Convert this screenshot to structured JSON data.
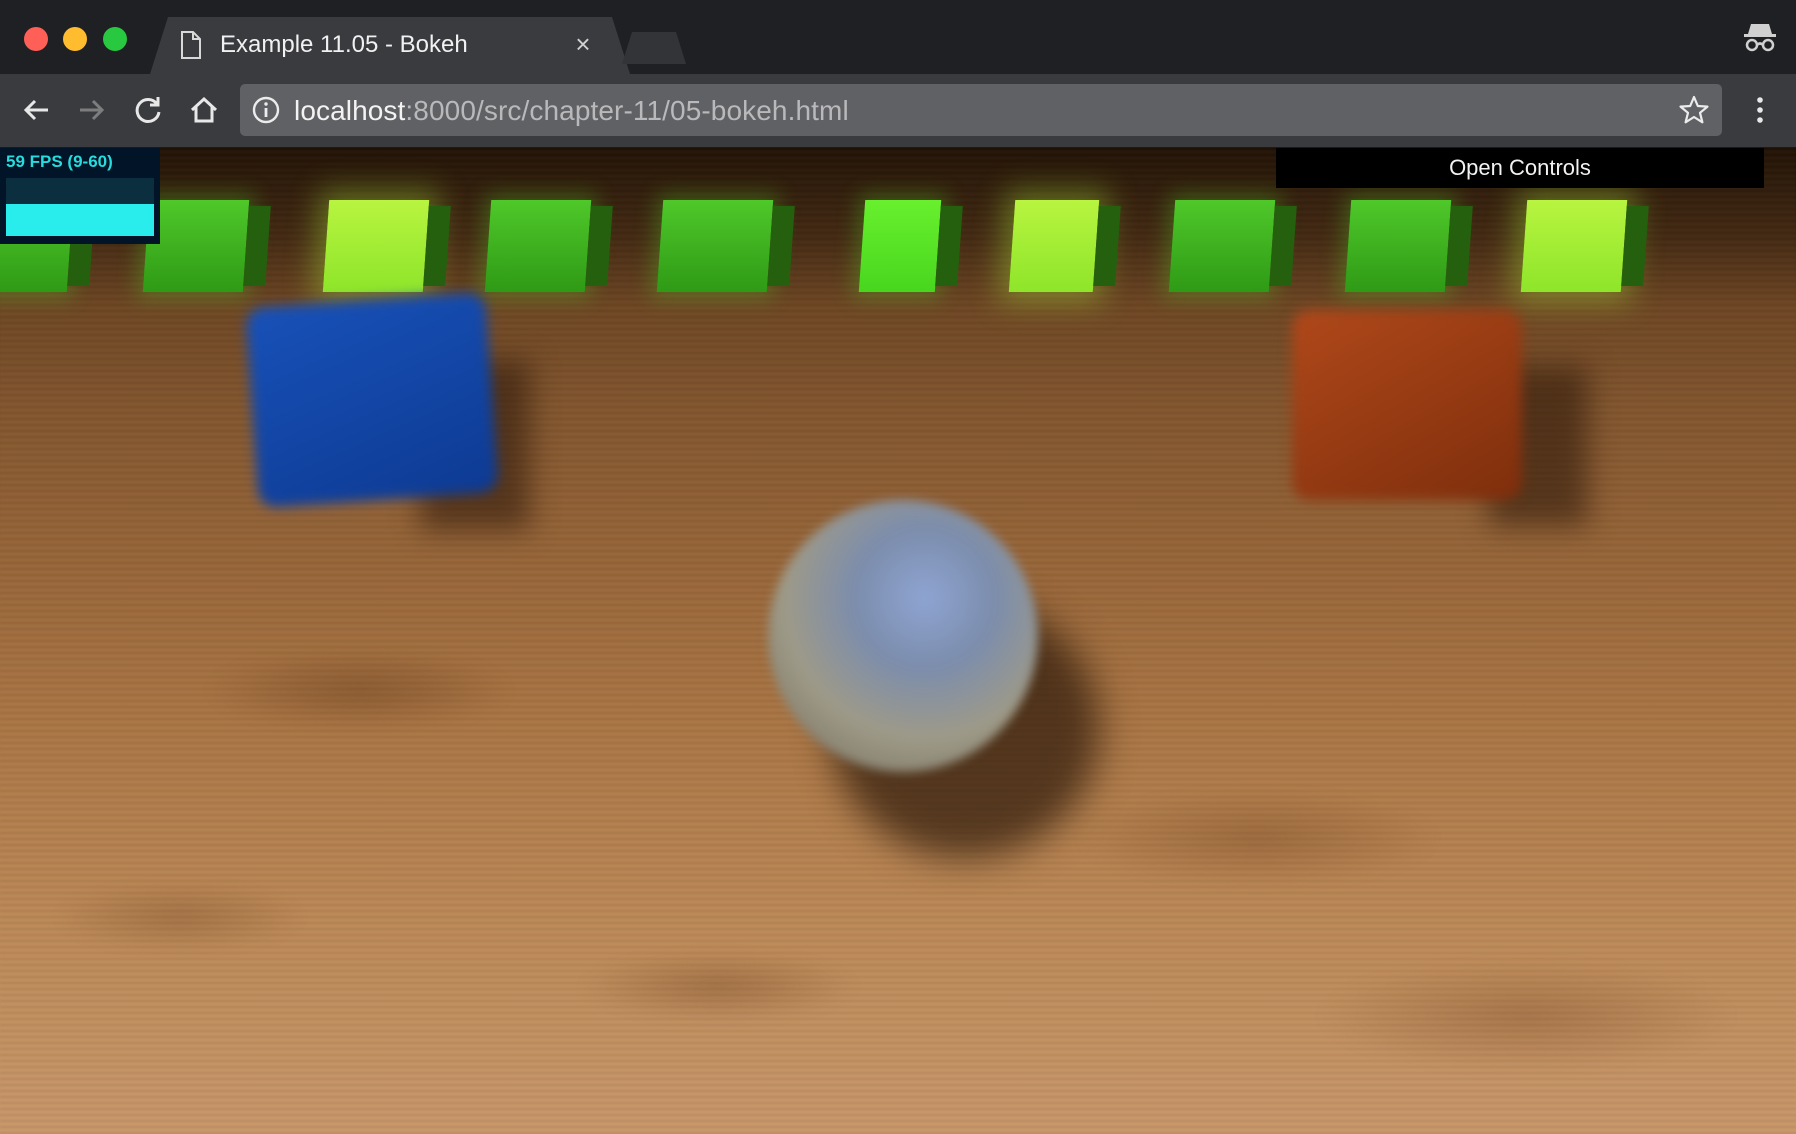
{
  "window": {
    "traffic_lights": [
      "close",
      "minimize",
      "maximize"
    ]
  },
  "tab": {
    "title": "Example 11.05 - Bokeh",
    "close_glyph": "×",
    "icon": "document-icon"
  },
  "toolbar": {
    "url_host": "localhost",
    "url_path": ":8000/src/chapter-11/05-bokeh.html",
    "icons": [
      "back-icon",
      "forward-icon",
      "reload-icon",
      "home-icon",
      "info-icon",
      "star-icon",
      "kebab-menu-icon",
      "incognito-icon"
    ]
  },
  "stats": {
    "fps_label": "59 FPS (9-60)",
    "graph_level": 0.55
  },
  "gui": {
    "toggle_label": "Open Controls"
  },
  "colors": {
    "fps_text": "#26dcdc",
    "fps_graph": "#29ecec",
    "stats_bg": "#011428"
  }
}
